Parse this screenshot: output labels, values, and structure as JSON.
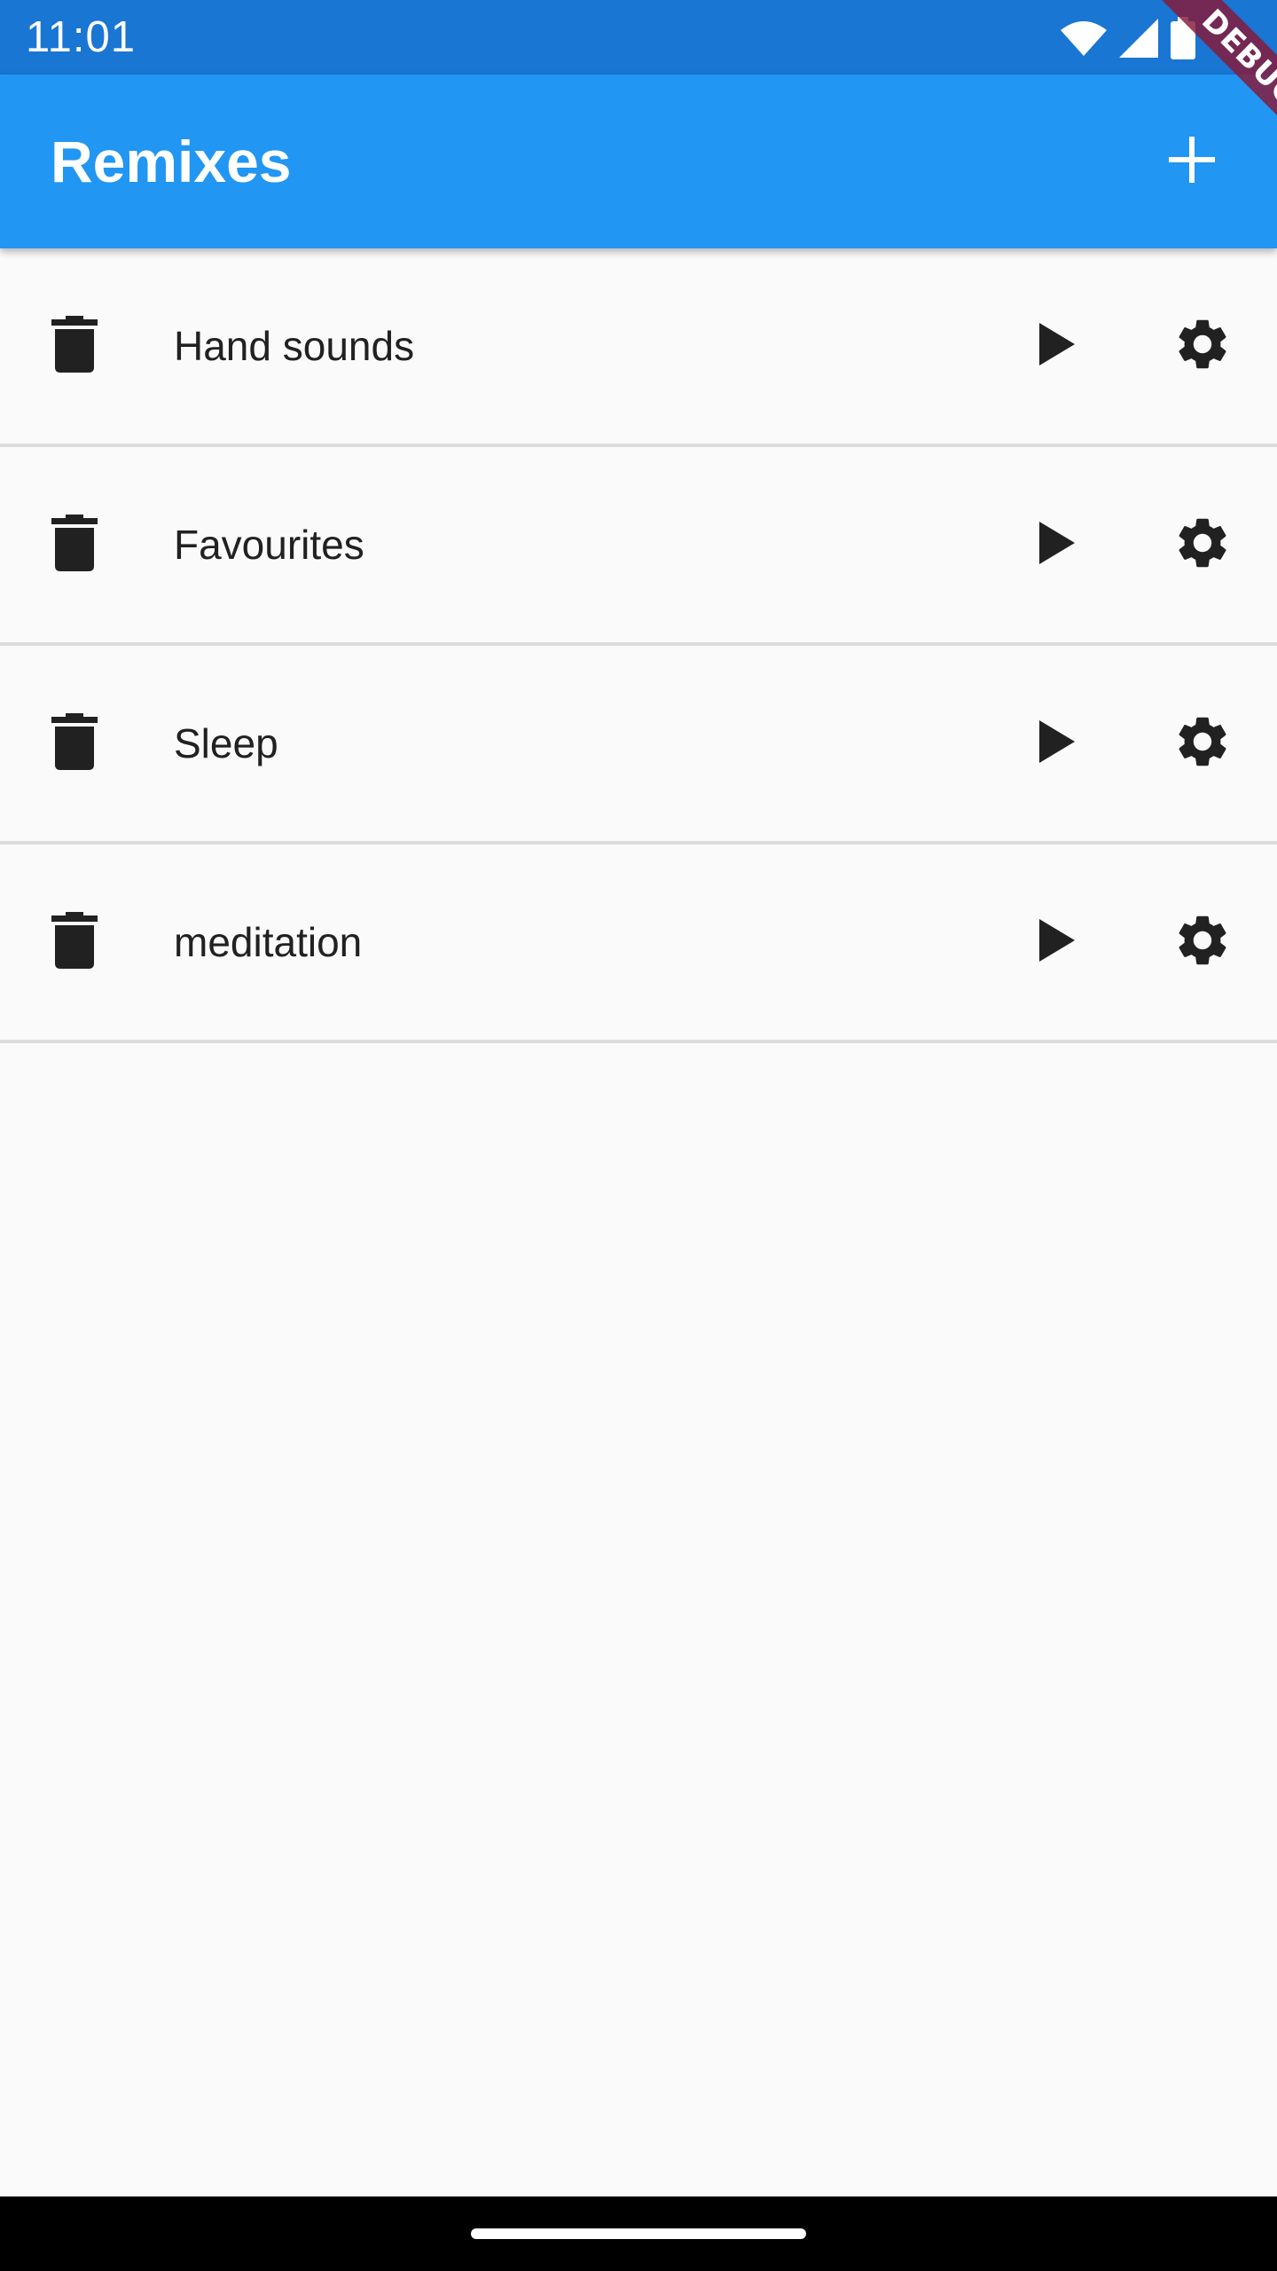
{
  "status_bar": {
    "time": "11:01",
    "icons": [
      "wifi-icon",
      "cell-signal-icon",
      "battery-icon"
    ]
  },
  "app_bar": {
    "title": "Remixes",
    "add_icon": "plus-icon"
  },
  "debug_banner": {
    "label": "DEBUG"
  },
  "remixes": [
    {
      "label": "Hand sounds"
    },
    {
      "label": "Favourites"
    },
    {
      "label": "Sleep"
    },
    {
      "label": "meditation"
    }
  ],
  "item_icons": {
    "delete": "trash-icon",
    "play": "play-icon",
    "settings": "gear-icon"
  },
  "colors": {
    "status_bar": "#1976d2",
    "app_bar": "#2196f3",
    "background": "#fafafa",
    "icon": "#212121",
    "divider": "#dcdcdc",
    "debug_ribbon": "#881838"
  }
}
